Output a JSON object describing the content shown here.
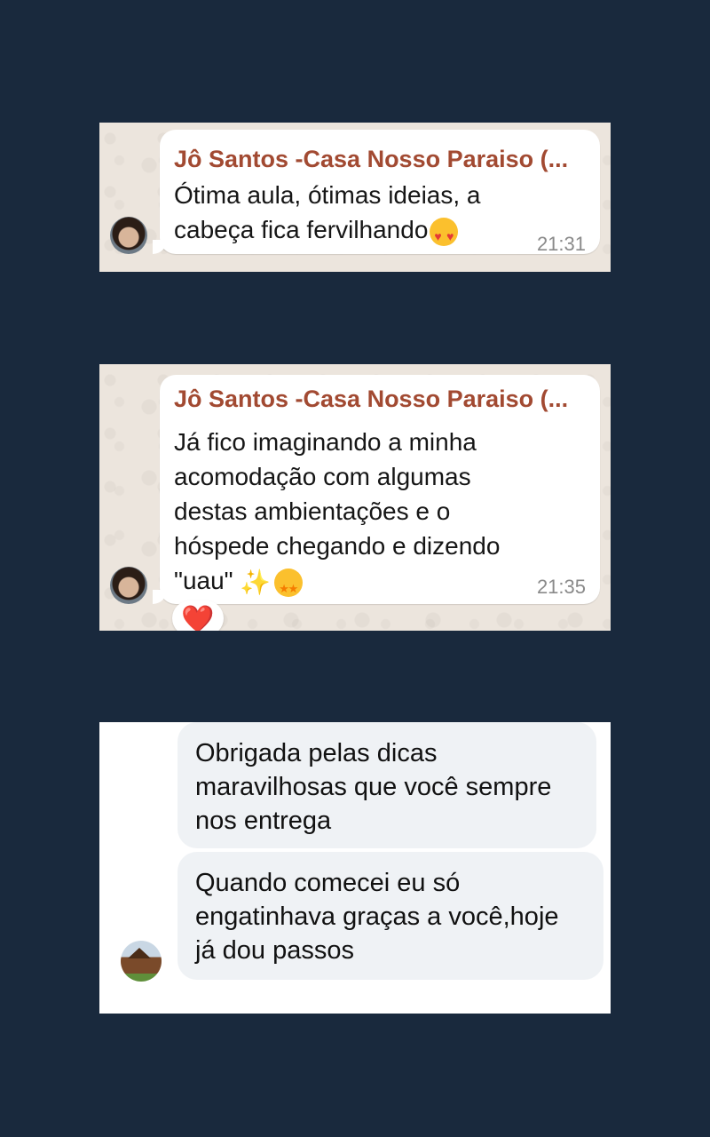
{
  "conversation_1": {
    "sender": "Jô Santos -Casa Nosso Paraiso (...",
    "message": "Ótima aula, ótimas ideias, a\ncabeça fica fervilhando",
    "emoji": "smiling-face-with-heart-eyes",
    "time": "21:31"
  },
  "conversation_2": {
    "sender": "Jô Santos -Casa Nosso Paraiso (...",
    "message": "Já fico imaginando a minha\nacomodação com algumas\ndestas ambientações e o\nhóspede chegando e dizendo\n\"uau\" ",
    "emojis": [
      "sparkles",
      "star-struck"
    ],
    "time": "21:35",
    "reaction": "❤️"
  },
  "conversation_3": {
    "messages": [
      {
        "text": "Obrigada pelas dicas\nmaravilhosas que você sempre\nnos entrega"
      },
      {
        "text": "Quando comecei eu só\nengatinhava graças a você,hoje\njá dou passos"
      }
    ]
  },
  "colors": {
    "page_background": "#19293d",
    "sender_name": "#a24a32",
    "bubble": "#ffffff",
    "group_bubble": "#eff2f5",
    "reaction_heart": "#e0182d"
  }
}
